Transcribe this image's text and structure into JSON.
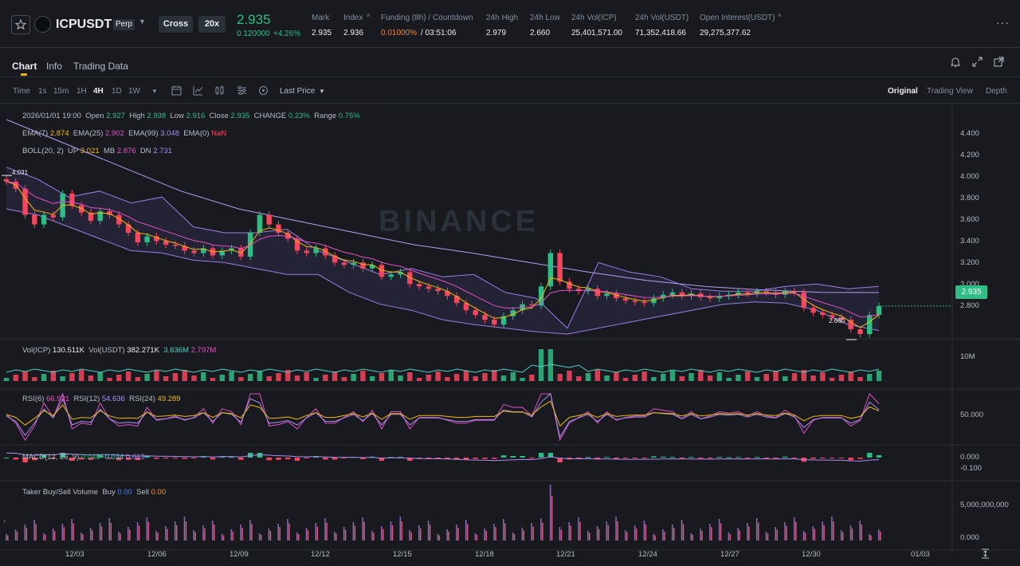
{
  "header": {
    "symbol": "ICPUSDT",
    "perp_badge": "Perp",
    "cross_label": "Cross",
    "leverage_label": "20x",
    "last_price": "2.935",
    "change_abs": "0.120000",
    "change_pct": "+4.26%",
    "stats": [
      {
        "label": "Mark",
        "value": "2.935"
      },
      {
        "label": "Index",
        "value": "2.936"
      },
      {
        "label": "Funding (8h) / Countdown",
        "value_a": "0.01000%",
        "value_b": "/ 03:51:06"
      },
      {
        "label": "24h High",
        "value": "2.979"
      },
      {
        "label": "24h Low",
        "value": "2.660"
      },
      {
        "label": "24h Vol(ICP)",
        "value": "25,401,571.00"
      },
      {
        "label": "24h Vol(USDT)",
        "value": "71,352,418.66"
      },
      {
        "label": "Open Interest(USDT)",
        "value": "29,275,377.62"
      }
    ],
    "more_icon": "more-icon",
    "star_icon": "star-icon"
  },
  "tabs": {
    "items": [
      "Chart",
      "Info",
      "Trading Data"
    ],
    "active": "Chart"
  },
  "toolbar": {
    "intervals": [
      "Time",
      "1s",
      "15m",
      "1H",
      "4H",
      "1D",
      "1W"
    ],
    "active_interval": "4H",
    "price_type": "Last Price",
    "views": [
      "Original",
      "Trading View",
      "Depth"
    ],
    "active_view": "Original"
  },
  "legend": {
    "date": "2026/01/01 19:00",
    "open_label": "Open",
    "open": "2.927",
    "high_label": "High",
    "high": "2.938",
    "low_label": "Low",
    "low": "2.916",
    "close_label": "Close",
    "close": "2.935",
    "change_label": "CHANGE",
    "change": "0.23%",
    "range_label": "Range",
    "range": "0.75%",
    "ema7_label": "EMA(7)",
    "ema7": "2.874",
    "ema25_label": "EMA(25)",
    "ema25": "2.902",
    "ema99_label": "EMA(99)",
    "ema99": "3.048",
    "ema0_label": "EMA(0)",
    "ema0": "NaN",
    "boll_label": "BOLL(20, 2)",
    "up_label": "UP",
    "up": "3.021",
    "mb_label": "MB",
    "mb": "2.876",
    "dn_label": "DN",
    "dn": "2.731",
    "vol_icp_label": "Vol(ICP)",
    "vol_icp": "130.511K",
    "vol_usdt_label": "Vol(USDT)",
    "vol_usdt": "382.271K",
    "vol_ma1": "3.636M",
    "vol_ma2": "2.797M",
    "rsi6_label": "RSI(6)",
    "rsi6": "66.921",
    "rsi12_label": "RSI(12)",
    "rsi12": "54.636",
    "rsi24_label": "RSI(24)",
    "rsi24": "49.289",
    "macd_label": "MACD(12, 26, 9)",
    "macd_a": "0.048",
    "macd_b": "-0.034",
    "macd_c": "0.013",
    "taker_label": "Taker Buy/Sell Volume",
    "buy_label": "Buy",
    "buy": "0.00",
    "sell_label": "Sell",
    "sell": "0.00"
  },
  "price_axis": [
    "4.400",
    "4.200",
    "4.000",
    "3.800",
    "3.600",
    "3.400",
    "3.200",
    "3.000",
    "2.800"
  ],
  "price_tag": "2.935",
  "max_label": "4.031",
  "min_label": "2.660",
  "vol_axis": "10M",
  "rsi_axis": "50.000",
  "macd_axis": [
    "0.000",
    "-0.100"
  ],
  "taker_axis": [
    "5,000,000,000",
    "0.000"
  ],
  "x_axis": [
    "12/03",
    "12/06",
    "12/09",
    "12/12",
    "12/15",
    "12/18",
    "12/21",
    "12/24",
    "12/27",
    "12/30",
    "01/03"
  ],
  "watermark": "BINANCE",
  "chart_data": {
    "type": "candlestick",
    "interval": "4H",
    "close_series": [
      3.98,
      3.92,
      3.7,
      3.62,
      3.7,
      3.68,
      3.88,
      3.78,
      3.72,
      3.65,
      3.73,
      3.7,
      3.62,
      3.55,
      3.47,
      3.52,
      3.48,
      3.45,
      3.44,
      3.4,
      3.38,
      3.42,
      3.36,
      3.4,
      3.42,
      3.35,
      3.55,
      3.7,
      3.62,
      3.55,
      3.5,
      3.4,
      3.38,
      3.42,
      3.36,
      3.3,
      3.28,
      3.3,
      3.25,
      3.28,
      3.18,
      3.2,
      3.22,
      3.12,
      3.1,
      3.08,
      3.06,
      3.02,
      2.96,
      2.9,
      2.86,
      2.82,
      2.78,
      2.85,
      2.9,
      2.95,
      2.94,
      3.1,
      3.38,
      3.14,
      3.08,
      3.06,
      3.08,
      3.02,
      3.04,
      3.0,
      2.98,
      2.97,
      2.96,
      3.0,
      3.03,
      3.05,
      3.02,
      3.04,
      3.01,
      3.0,
      3.02,
      3.03,
      3.05,
      3.04,
      3.06,
      3.05,
      3.03,
      3.06,
      3.05,
      2.92,
      2.88,
      2.86,
      2.84,
      2.82,
      2.74,
      2.7,
      2.86,
      2.935
    ],
    "boll_up": [
      4.1,
      4.0,
      3.85,
      3.9,
      3.8,
      3.85,
      3.6,
      3.55,
      3.55,
      3.58,
      3.4,
      3.3,
      3.2,
      3.25,
      3.18,
      3.2,
      3.05,
      3.0,
      2.75,
      3.3,
      3.22,
      3.18,
      3.08,
      3.06,
      3.06,
      3.1,
      3.12,
      3.08,
      3.1
    ],
    "boll_dn": [
      3.75,
      3.7,
      3.6,
      3.5,
      3.4,
      3.38,
      3.32,
      3.3,
      3.25,
      3.2,
      3.2,
      3.05,
      2.95,
      2.9,
      2.82,
      2.78,
      2.75,
      2.72,
      2.7,
      2.75,
      2.8,
      2.85,
      2.9,
      2.95,
      2.97,
      2.96,
      2.9,
      2.78,
      2.73
    ],
    "ema99": [
      4.5,
      4.3,
      4.1,
      3.9,
      3.75,
      3.65,
      3.55,
      3.45,
      3.38,
      3.3,
      3.22,
      3.15,
      3.1,
      3.07,
      3.05,
      3.048
    ],
    "y_range": [
      2.6,
      4.5
    ],
    "x_ticks": [
      "12/03",
      "12/06",
      "12/09",
      "12/12",
      "12/15",
      "12/18",
      "12/21",
      "12/24",
      "12/27",
      "12/30",
      "01/03"
    ],
    "price_ticks": [
      4.4,
      4.2,
      4.0,
      3.8,
      3.6,
      3.4,
      3.2,
      3.0,
      2.8
    ]
  }
}
